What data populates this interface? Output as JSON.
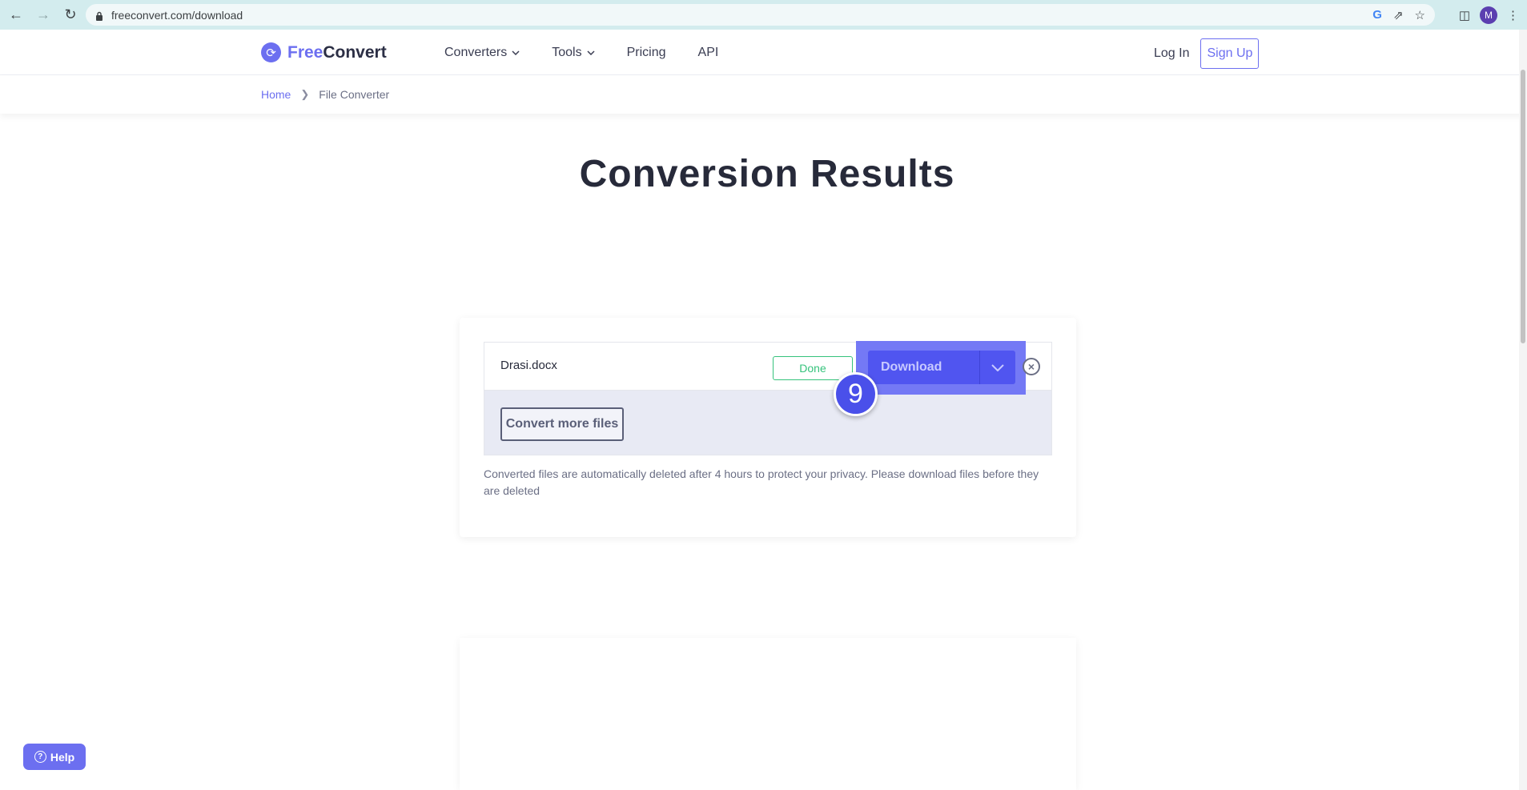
{
  "browser": {
    "url": "freeconvert.com/download",
    "avatar_initial": "M"
  },
  "header": {
    "logo_free": "Free",
    "logo_convert": "Convert",
    "nav": [
      {
        "label": "Converters"
      },
      {
        "label": "Tools"
      },
      {
        "label": "Pricing"
      },
      {
        "label": "API"
      }
    ],
    "login_label": "Log In",
    "signup_label": "Sign Up"
  },
  "breadcrumb": {
    "home": "Home",
    "current": "File Converter"
  },
  "main": {
    "title": "Conversion Results",
    "file": {
      "name": "Drasi.docx",
      "status": "Done",
      "download_label": "Download"
    },
    "convert_more_label": "Convert more files",
    "privacy_note": "Converted files are automatically deleted after 4 hours to protect your privacy. Please download files before they are deleted",
    "step_number": "9"
  },
  "help": {
    "label": "Help"
  },
  "colors": {
    "brand": "#6c6ff0",
    "download_button": "#5055f0",
    "done_status": "#36c37c"
  }
}
